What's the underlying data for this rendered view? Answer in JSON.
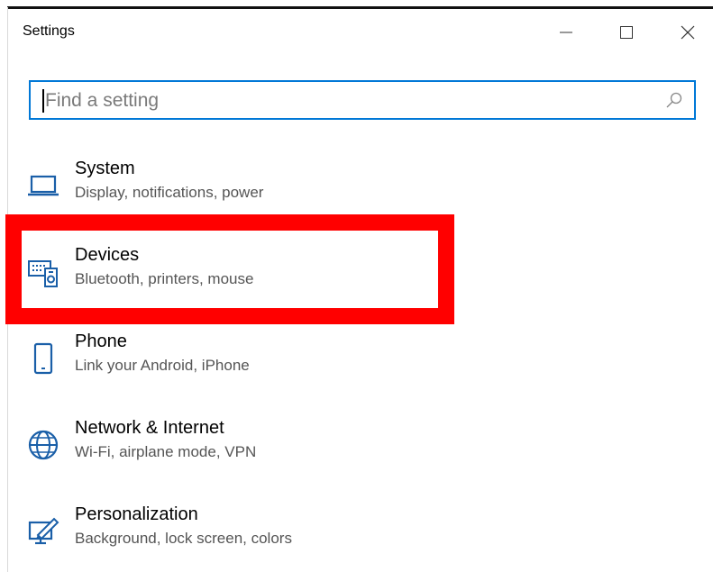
{
  "window": {
    "title": "Settings",
    "controls": {
      "minimize": "minimize",
      "maximize": "maximize",
      "close": "close"
    }
  },
  "search": {
    "placeholder": "Find a setting",
    "value": ""
  },
  "categories": [
    {
      "title": "System",
      "subtitle": "Display, notifications, power",
      "icon": "laptop-icon"
    },
    {
      "title": "Devices",
      "subtitle": "Bluetooth, printers, mouse",
      "icon": "devices-icon",
      "highlighted": true
    },
    {
      "title": "Phone",
      "subtitle": "Link your Android, iPhone",
      "icon": "phone-icon"
    },
    {
      "title": "Network & Internet",
      "subtitle": "Wi-Fi, airplane mode, VPN",
      "icon": "globe-icon"
    },
    {
      "title": "Personalization",
      "subtitle": "Background, lock screen, colors",
      "icon": "personalization-icon"
    }
  ],
  "colors": {
    "accent": "#0078d7",
    "highlight": "#ff0000",
    "icon": "#1a5fa8",
    "subtitle": "#555555"
  }
}
